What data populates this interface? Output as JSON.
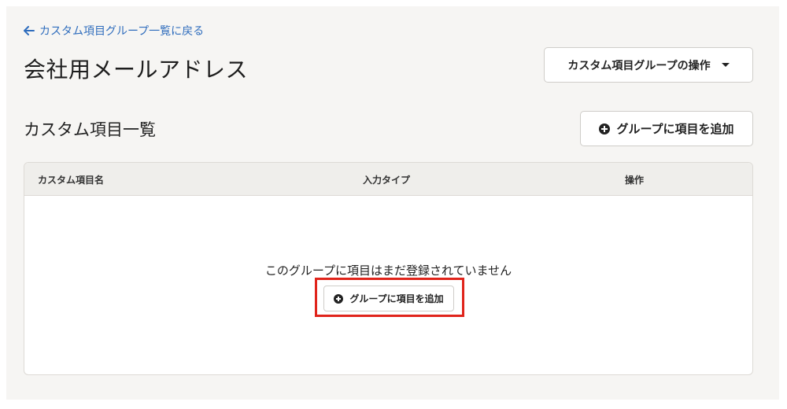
{
  "header": {
    "back_label": "カスタム項目グループ一覧に戻る",
    "title": "会社用メールアドレス",
    "actions_button_label": "カスタム項目グループの操作"
  },
  "section": {
    "title": "カスタム項目一覧",
    "add_button_label": "グループに項目を追加"
  },
  "table": {
    "columns": [
      "カスタム項目名",
      "入力タイプ",
      "操作"
    ],
    "empty_message": "このグループに項目はまだ登録されていません",
    "empty_add_button_label": "グループに項目を追加"
  },
  "colors": {
    "link": "#2f6dbd",
    "highlight": "#e0241b",
    "background": "#f6f5f3"
  },
  "icons": {
    "back": "arrow-left-icon",
    "add": "plus-circle-icon",
    "dropdown": "caret-down-icon"
  }
}
